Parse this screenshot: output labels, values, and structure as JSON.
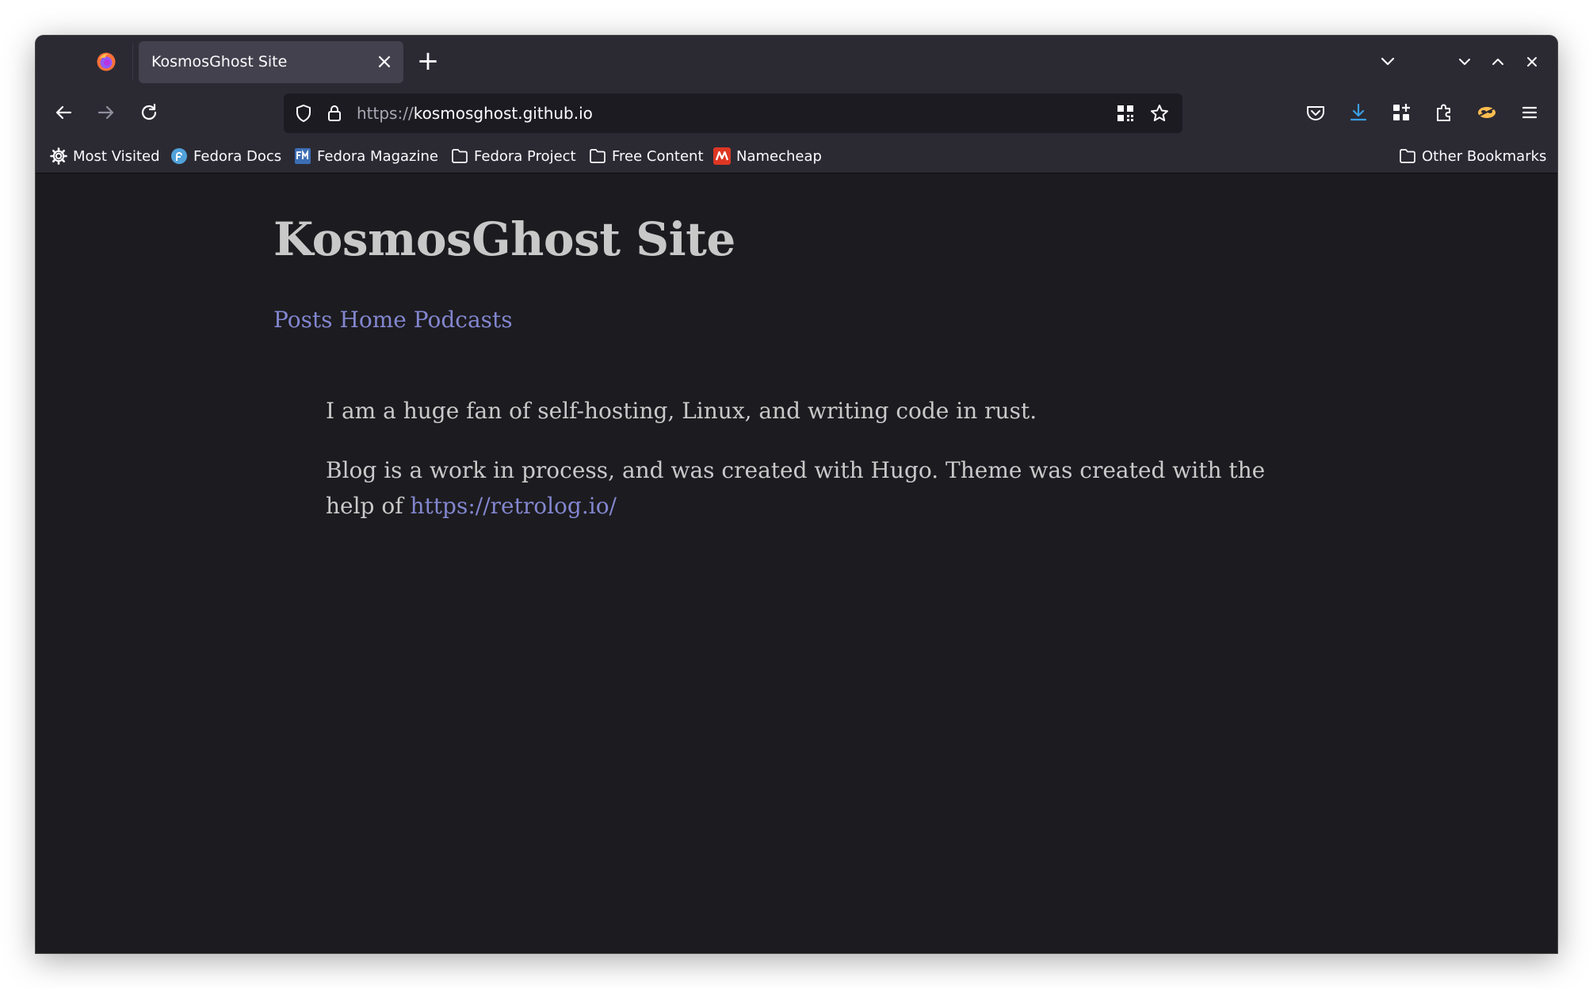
{
  "browser": {
    "tab": {
      "title": "KosmosGhost Site",
      "close_glyph": "×"
    },
    "newtab_glyph": "+",
    "url": {
      "scheme": "https://",
      "host": "kosmosghost.github.io"
    },
    "icons": {
      "firefox": "firefox-logo-icon",
      "back": "arrow-left-icon",
      "forward": "arrow-right-icon",
      "reload": "reload-icon",
      "shield": "tracking-protection-shield-icon",
      "lock": "lock-icon",
      "qr": "qr-code-icon",
      "star": "star-bookmark-icon",
      "pocket": "pocket-icon",
      "download": "download-icon",
      "extensions_grid": "add-ons-grid-icon",
      "puzzle": "extensions-puzzle-icon",
      "account": "account-mask-icon",
      "menu": "hamburger-menu-icon"
    },
    "accent_color": "#3b9ee0"
  },
  "bookmarks": {
    "items": [
      {
        "label": "Most Visited",
        "icon": "gear-icon"
      },
      {
        "label": "Fedora Docs",
        "icon": "fedora-icon"
      },
      {
        "label": "Fedora Magazine",
        "icon": "fedora-magazine-icon"
      },
      {
        "label": "Fedora Project",
        "icon": "folder-icon"
      },
      {
        "label": "Free Content",
        "icon": "folder-icon"
      },
      {
        "label": "Namecheap",
        "icon": "namecheap-icon"
      }
    ],
    "other": {
      "label": "Other Bookmarks",
      "icon": "folder-icon"
    }
  },
  "page": {
    "title": "KosmosGhost Site",
    "nav": [
      "Posts",
      "Home",
      "Podcasts"
    ],
    "paragraph1": "I am a huge fan of self-hosting, Linux, and writing code in rust.",
    "paragraph2_text": "Blog is a work in process, and was created with Hugo. Theme was created with the help of ",
    "paragraph2_link": "https://retrolog.io/",
    "link_color": "#8286cf",
    "text_color": "#c9c9c9",
    "background": "#1c1b1f"
  }
}
